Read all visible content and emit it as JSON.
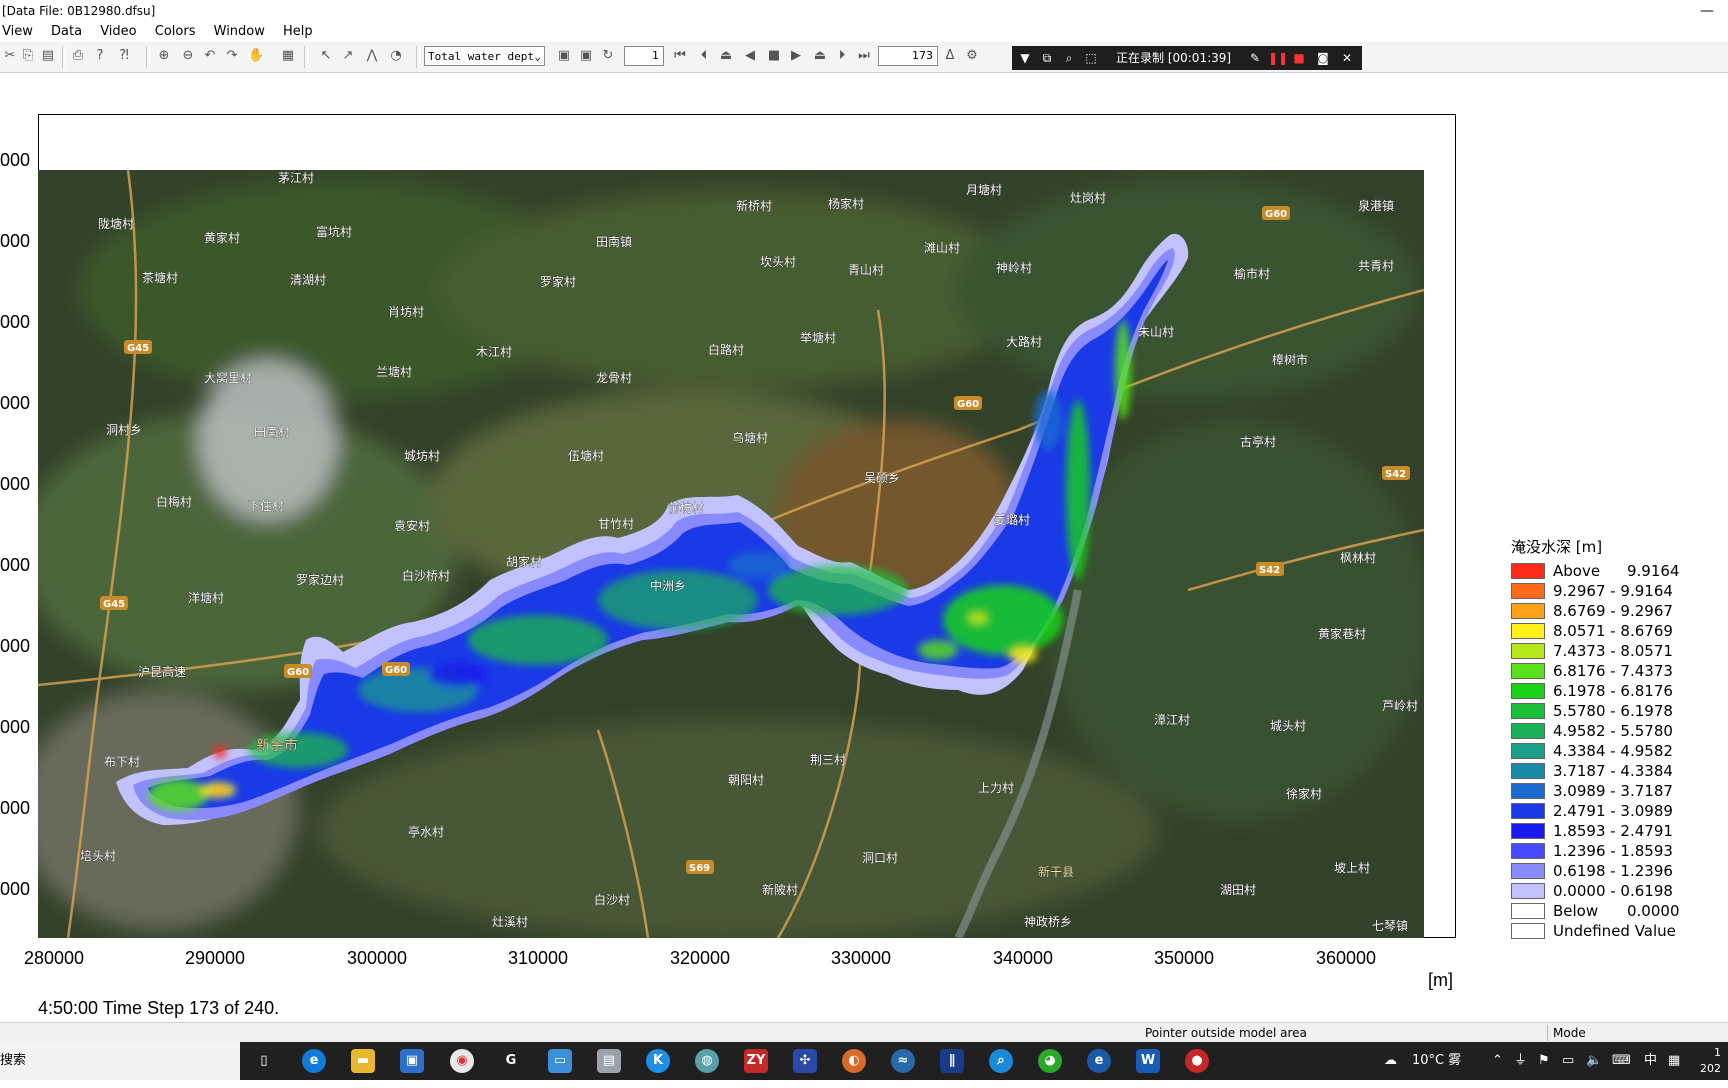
{
  "window": {
    "title": "[Data File: 0B12980.dfsu]",
    "minimize_glyph": "—"
  },
  "menu": [
    "View",
    "Data",
    "Video",
    "Colors",
    "Window",
    "Help"
  ],
  "toolbar": {
    "item_select": "Total water dept",
    "step_start": "1",
    "step_current": "173",
    "recording_text": "正在录制 [00:01:39]",
    "recording_color": "#1e1e1e"
  },
  "map": {
    "background_color": "#3a4a2a",
    "water_color": "#c7d9a8",
    "ticks_y": [
      "000",
      "000",
      "000",
      "000",
      "000",
      "000",
      "000",
      "000",
      "000",
      "000"
    ],
    "ticks_x": [
      "280000",
      "290000",
      "300000",
      "310000",
      "320000",
      "330000",
      "340000",
      "350000",
      "360000"
    ],
    "unit": "[m]",
    "place_labels": [
      "茅江村",
      "陇塘村",
      "黄家村",
      "富坑村",
      "茶塘村",
      "清湖村",
      "田南镇",
      "罗家村",
      "新桥村",
      "杨家村",
      "月塘村",
      "灶岗村",
      "泉港镇",
      "坎头村",
      "青山村",
      "滩山村",
      "神岭村",
      "榆市村",
      "共青村",
      "肖坊村",
      "木江村",
      "白路村",
      "举塘村",
      "大路村",
      "朱山村",
      "樟树市",
      "大窝里村",
      "兰塘村",
      "龙骨村",
      "乌塘村",
      "洞村乡",
      "田南村",
      "城坊村",
      "伍塘村",
      "吴硕乡",
      "古亭村",
      "白梅村",
      "下住村",
      "袁安村",
      "甘竹村",
      "前坊村",
      "姜璐村",
      "罗家边村",
      "白沙桥村",
      "胡家村",
      "中洲乡",
      "枫林村",
      "洋塘村",
      "黄家巷村",
      "沪昆高速",
      "新余市",
      "漳江村",
      "城头村",
      "芦岭村",
      "布下村",
      "荆三村",
      "朝阳村",
      "上力村",
      "徐家村",
      "亭水村",
      "洞口村",
      "培头村",
      "新陂村",
      "新干县",
      "坡上村",
      "白沙村",
      "湖田村",
      "灶溪村",
      "神政桥乡",
      "七琴镇"
    ],
    "shields": [
      "G45",
      "G45",
      "G60",
      "G60",
      "G60",
      "G60",
      "S42",
      "S42",
      "S69"
    ]
  },
  "legend": {
    "title": "淹没水深 [m]",
    "entries": [
      {
        "label": "Above",
        "range": "9.9164",
        "color": "#ff2a1a"
      },
      {
        "label": "9.2967 - 9.9164",
        "range": "",
        "color": "#ff6a1a"
      },
      {
        "label": "8.6769 - 9.2967",
        "range": "",
        "color": "#ffa21a"
      },
      {
        "label": "8.0571 - 8.6769",
        "range": "",
        "color": "#fff01a"
      },
      {
        "label": "7.4373 - 8.0571",
        "range": "",
        "color": "#b8e81a"
      },
      {
        "label": "6.8176 - 7.4373",
        "range": "",
        "color": "#58e01a"
      },
      {
        "label": "6.1978 - 6.8176",
        "range": "",
        "color": "#1ad21a"
      },
      {
        "label": "5.5780 - 6.1978",
        "range": "",
        "color": "#1ac03a"
      },
      {
        "label": "4.9582 - 5.5780",
        "range": "",
        "color": "#1ab05a"
      },
      {
        "label": "4.3384 - 4.9582",
        "range": "",
        "color": "#1aa088"
      },
      {
        "label": "3.7187 - 4.3384",
        "range": "",
        "color": "#1a8aa8"
      },
      {
        "label": "3.0989 - 3.7187",
        "range": "",
        "color": "#1a6ad0"
      },
      {
        "label": "2.4791 - 3.0989",
        "range": "",
        "color": "#1a3ae8"
      },
      {
        "label": "1.8593 - 2.4791",
        "range": "",
        "color": "#1a1aee"
      },
      {
        "label": "1.2396 - 1.8593",
        "range": "",
        "color": "#4a4aff"
      },
      {
        "label": "0.6198 - 1.2396",
        "range": "",
        "color": "#8a8aff"
      },
      {
        "label": "0.0000 - 0.6198",
        "range": "",
        "color": "#c2c2ff"
      },
      {
        "label": "Below",
        "range": "0.0000",
        "color": "#ffffff"
      },
      {
        "label": "Undefined Value",
        "range": "",
        "color": "#ffffff"
      }
    ]
  },
  "time_step_text": "4:50:00 Time Step 173 of 240.",
  "status": {
    "pointer_text": "Pointer outside model area",
    "mode_label": "Mode"
  },
  "taskbar": {
    "search_text": "搜索",
    "weather": "10°C 雾",
    "ime_lang": "中",
    "clock_partial_top": "1",
    "clock_partial_bottom": "202"
  }
}
